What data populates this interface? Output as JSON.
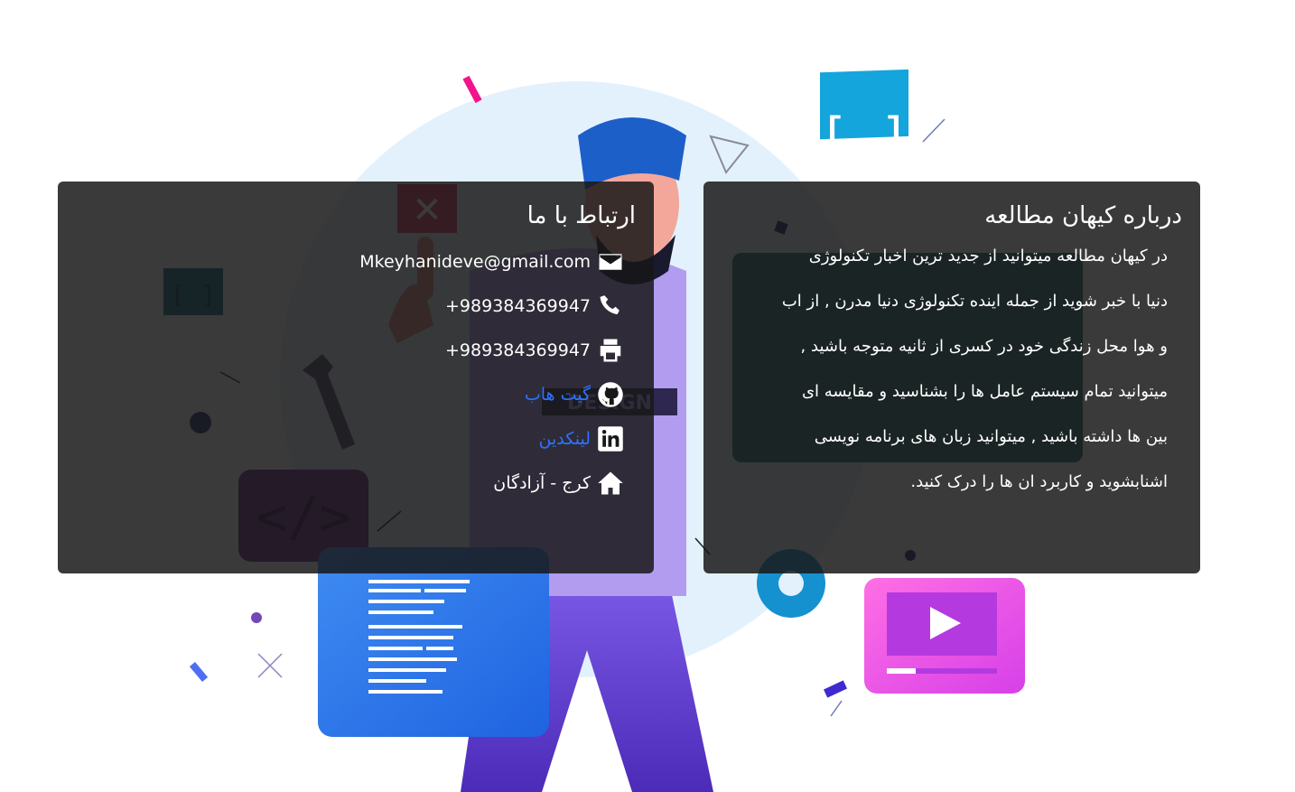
{
  "about": {
    "title": "درباره کیهان مطالعه",
    "lines": [
      "در کیهان مطالعه میتوانید از جدید ترین اخبار تکنولوژی",
      "دنیا با خبر شوید از جمله اینده تکنولوژی دنیا مدرن , از اب",
      "و هوا محل زندگی خود در کسری از ثانیه متوجه باشید ,",
      "میتوانید تمام سیستم عامل ها را بشناسید و مقایسه ای",
      "بین ها داشته باشید , میتوانید زبان های برنامه نویسی",
      "اشنابشوید و کاربرد ان ها را درک کنید."
    ]
  },
  "contact": {
    "title": "ارتباط با ما",
    "email": "Mkeyhanideve@gmail.com",
    "phone": "+989384369947",
    "fax": "+989384369947",
    "github_label": "گیت هاب",
    "linkedin_label": "لینکدین",
    "address": "کرج - آزادگان",
    "icons": {
      "email": "envelope-icon",
      "phone": "phone-icon",
      "fax": "printer-icon",
      "github": "github-icon",
      "linkedin": "linkedin-icon",
      "address": "home-icon"
    }
  },
  "colors": {
    "card_bg": "#181818",
    "link": "#2d74ff",
    "text": "#ffffff"
  }
}
